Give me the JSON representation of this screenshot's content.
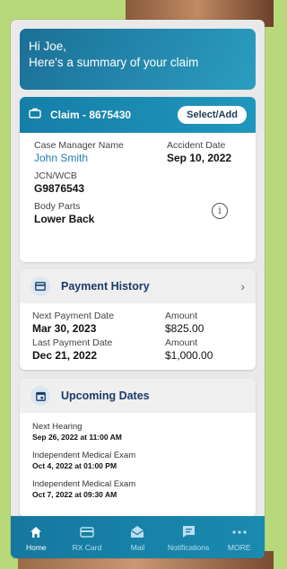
{
  "greeting": {
    "line1": "Hi Joe,",
    "line2": "Here's a summary of your claim"
  },
  "claim": {
    "title": "Claim - 8675430",
    "select_label": "Select/Add",
    "case_manager_label": "Case Manager Name",
    "case_manager_value": "John Smith",
    "accident_date_label": "Accident Date",
    "accident_date_value": "Sep 10, 2022",
    "jcn_label": "JCN/WCB",
    "jcn_value": "G9876543",
    "body_parts_label": "Body Parts",
    "body_parts_value": "Lower Back",
    "info_glyph": "i"
  },
  "payment_history": {
    "title": "Payment History",
    "next_label": "Next Payment Date",
    "next_value": "Mar 30, 2023",
    "amount_label_1": "Amount",
    "amount_value_1": "$825.00",
    "last_label": "Last Payment Date",
    "last_value": "Dec 21, 2022",
    "amount_label_2": "Amount",
    "amount_value_2": "$1,000.00"
  },
  "upcoming_dates": {
    "title": "Upcoming Dates",
    "items": [
      {
        "label": "Next Hearing",
        "value": "Sep 26, 2022 at 11:00 AM"
      },
      {
        "label": "Independent Medical Exam",
        "value": "Oct 4, 2022 at 01:00 PM"
      },
      {
        "label": "Independent Medical Exam",
        "value": "Oct 7, 2022 at 09:30 AM"
      }
    ]
  },
  "nav": {
    "items": [
      {
        "label": "Home",
        "icon": "home-icon"
      },
      {
        "label": "RX Card",
        "icon": "card-icon"
      },
      {
        "label": "Mail",
        "icon": "mail-icon"
      },
      {
        "label": "Notifications",
        "icon": "chat-icon"
      },
      {
        "label": "MORE",
        "icon": "more-icon"
      }
    ]
  },
  "colors": {
    "header_blue": "#1a8ab0",
    "title_navy": "#1a3b6b",
    "link_blue": "#1e7db5",
    "frame_green": "#b8d97a"
  }
}
